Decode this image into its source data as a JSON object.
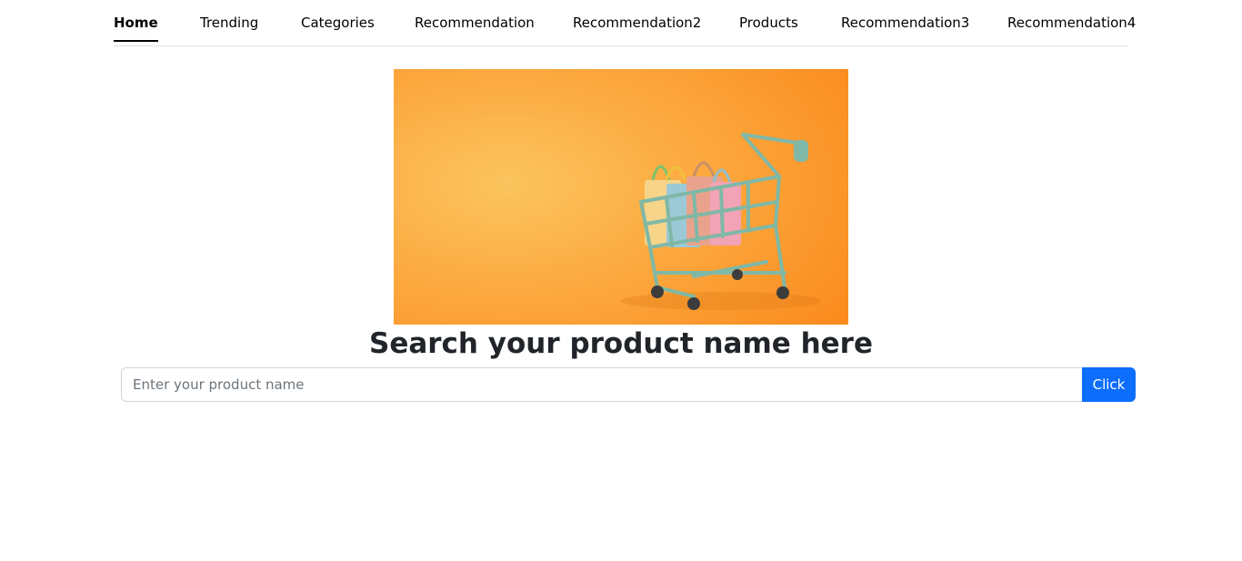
{
  "nav": {
    "items": [
      {
        "label": "Home",
        "active": true
      },
      {
        "label": "Trending"
      },
      {
        "label": "Categories"
      },
      {
        "label": "Recommendation"
      },
      {
        "label": "Recommendation2"
      },
      {
        "label": "Products"
      },
      {
        "label": "Recommendation3"
      },
      {
        "label": "Recommendation4"
      }
    ]
  },
  "hero": {
    "image": "shopping-cart-with-bags",
    "background_colors": [
      "#fcc45e",
      "#fb8b1e"
    ],
    "cart_color": "#7fb8a6",
    "bag_colors": [
      "#f6d58a",
      "#9cc9d6",
      "#e9a38c",
      "#f2a3b5"
    ]
  },
  "main": {
    "heading": "Search your product name here"
  },
  "search": {
    "placeholder": "Enter your product name",
    "value": "",
    "button_label": "Click",
    "button_color": "#0d6efd"
  }
}
